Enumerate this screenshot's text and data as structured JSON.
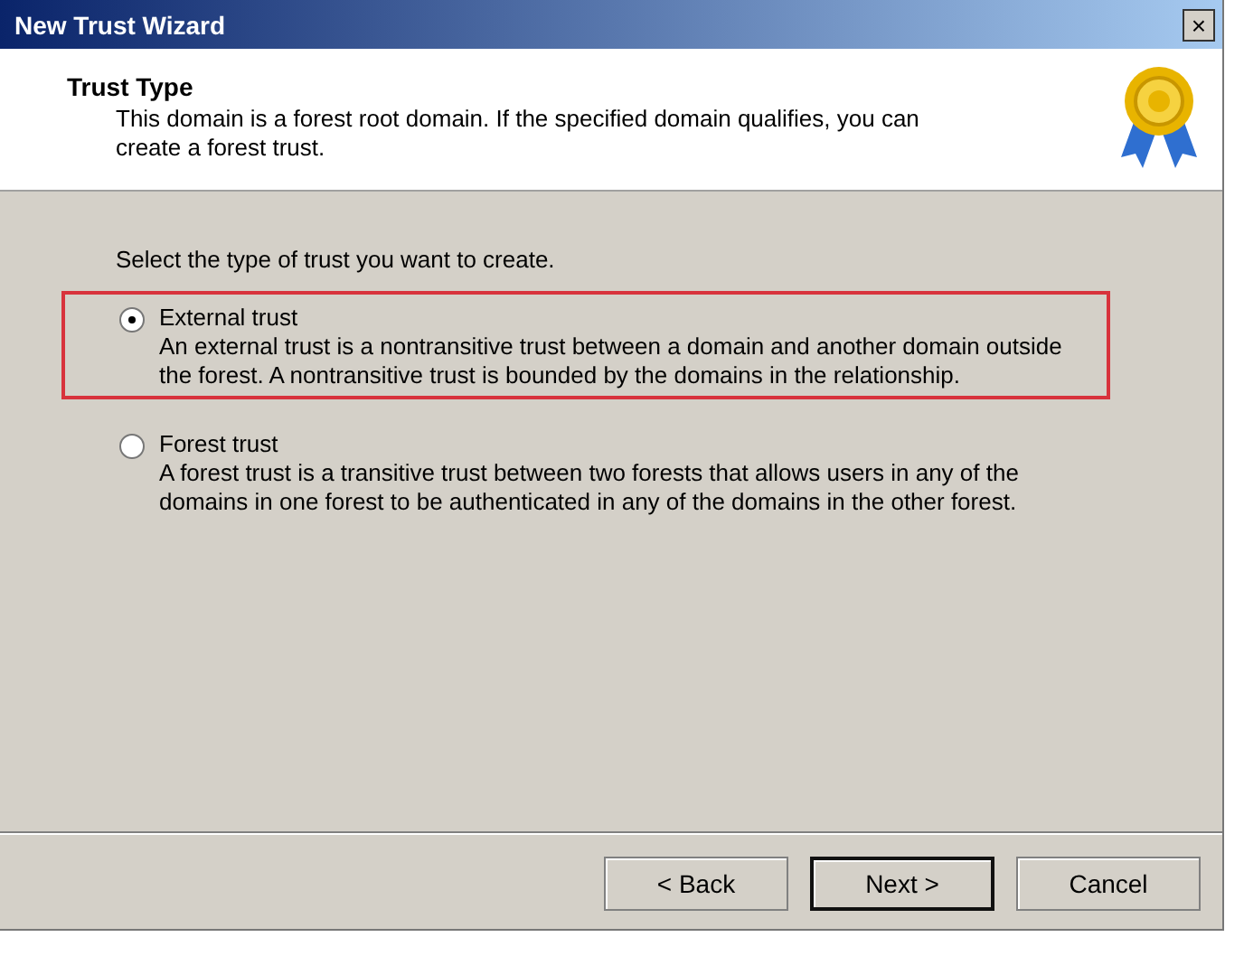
{
  "window": {
    "title": "New Trust Wizard",
    "close": "×"
  },
  "header": {
    "title": "Trust Type",
    "description": "This domain is a forest root domain. If the specified domain qualifies, you can create a forest trust."
  },
  "prompt": "Select the type of trust you want to create.",
  "options": [
    {
      "label": "External trust",
      "description": "An external trust is a nontransitive trust between a domain and another domain outside the forest. A nontransitive trust is bounded by the domains in the relationship.",
      "selected": true,
      "highlighted": true
    },
    {
      "label": "Forest trust",
      "description": "A forest trust is a transitive trust between two forests that allows users in any of the domains in one forest to be authenticated in any of the domains in the other forest.",
      "selected": false,
      "highlighted": false
    }
  ],
  "buttons": [
    {
      "label": "< Back",
      "default": false
    },
    {
      "label": "Next >",
      "default": true
    },
    {
      "label": "Cancel",
      "default": false
    }
  ]
}
